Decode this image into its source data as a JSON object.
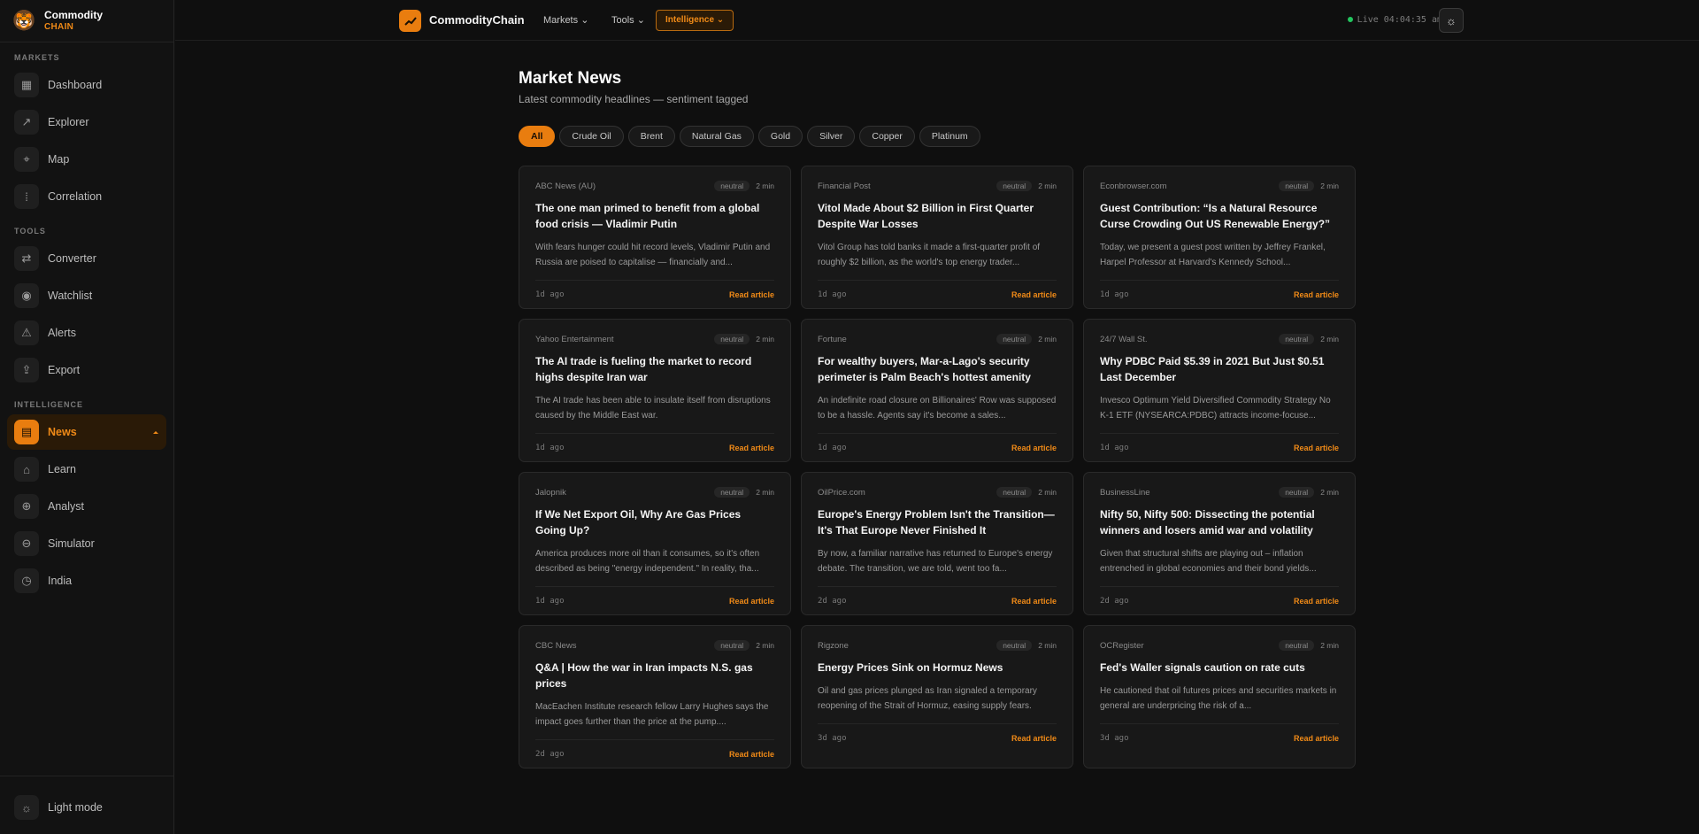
{
  "brand": {
    "name": "Commodity",
    "sub": "CHAIN"
  },
  "sidebar": {
    "sections": [
      {
        "heading": "MARKETS",
        "items": [
          {
            "label": "Dashboard",
            "icon": "grid-icon",
            "glyph": "▦"
          },
          {
            "label": "Explorer",
            "icon": "trend-line-icon",
            "glyph": "↗"
          },
          {
            "label": "Map",
            "icon": "map-pin-icon",
            "glyph": "⌖"
          },
          {
            "label": "Correlation",
            "icon": "dots-grid-icon",
            "glyph": "⁞"
          }
        ]
      },
      {
        "heading": "TOOLS",
        "items": [
          {
            "label": "Converter",
            "icon": "swap-icon",
            "glyph": "⇄"
          },
          {
            "label": "Watchlist",
            "icon": "eye-icon",
            "glyph": "◉"
          },
          {
            "label": "Alerts",
            "icon": "warning-icon",
            "glyph": "⚠"
          },
          {
            "label": "Export",
            "icon": "upload-icon",
            "glyph": "⇪"
          }
        ]
      },
      {
        "heading": "INTELLIGENCE",
        "items": [
          {
            "label": "News",
            "icon": "news-icon",
            "glyph": "▤",
            "active": true
          },
          {
            "label": "Learn",
            "icon": "graduation-cap-icon",
            "glyph": "⌂"
          },
          {
            "label": "Analyst",
            "icon": "plus-circle-icon",
            "glyph": "⊕"
          },
          {
            "label": "Simulator",
            "icon": "toggle-icon",
            "glyph": "⊖"
          },
          {
            "label": "India",
            "icon": "clock-icon",
            "glyph": "◷"
          }
        ]
      }
    ],
    "footer": {
      "label": "Light mode",
      "icon": "sun-icon",
      "glyph": "☼"
    }
  },
  "topbar": {
    "brand": "CommodityChain",
    "menus": {
      "markets": "Markets",
      "tools": "Tools",
      "intelligence": "Intelligence"
    },
    "live": "Live 04:04:35 am"
  },
  "main": {
    "title": "Market News",
    "subtitle": "Latest commodity headlines — sentiment tagged",
    "filters": [
      "All",
      "Crude Oil",
      "Brent",
      "Natural Gas",
      "Gold",
      "Silver",
      "Copper",
      "Platinum"
    ],
    "active_filter": "All",
    "read_label": "Read article",
    "articles": [
      {
        "source": "ABC News (AU)",
        "sentiment": "neutral",
        "read": "2 min",
        "title": "The one man primed to benefit from a global food crisis — Vladimir Putin",
        "desc": "With fears hunger could hit record levels, Vladimir Putin and Russia are poised to capitalise — financially and...",
        "ago": "1d ago"
      },
      {
        "source": "Financial Post",
        "sentiment": "neutral",
        "read": "2 min",
        "title": "Vitol Made About $2 Billion in First Quarter Despite War Losses",
        "desc": "Vitol Group has told banks it made a first-quarter profit of roughly $2 billion, as the world's top energy trader...",
        "ago": "1d ago"
      },
      {
        "source": "Econbrowser.com",
        "sentiment": "neutral",
        "read": "2 min",
        "title": "Guest Contribution: “Is a Natural Resource Curse Crowding Out US Renewable Energy?”",
        "desc": "Today, we present a guest post written by Jeffrey Frankel, Harpel Professor at Harvard's Kennedy School...",
        "ago": "1d ago"
      },
      {
        "source": "Yahoo Entertainment",
        "sentiment": "neutral",
        "read": "2 min",
        "title": "The AI trade is fueling the market to record highs despite Iran war",
        "desc": "The AI trade has been able to insulate itself from disruptions caused by the Middle East war.",
        "ago": "1d ago"
      },
      {
        "source": "Fortune",
        "sentiment": "neutral",
        "read": "2 min",
        "title": "For wealthy buyers, Mar-a-Lago's security perimeter is Palm Beach's hottest amenity",
        "desc": "An indefinite road closure on Billionaires' Row was supposed to be a hassle. Agents say it's become a sales...",
        "ago": "1d ago"
      },
      {
        "source": "24/7 Wall St.",
        "sentiment": "neutral",
        "read": "2 min",
        "title": "Why PDBC Paid $5.39 in 2021 But Just $0.51 Last December",
        "desc": "Invesco Optimum Yield Diversified Commodity Strategy No K-1 ETF (NYSEARCA:PDBC) attracts income-focuse...",
        "ago": "1d ago"
      },
      {
        "source": "Jalopnik",
        "sentiment": "neutral",
        "read": "2 min",
        "title": "If We Net Export Oil, Why Are Gas Prices Going Up?",
        "desc": "America produces more oil than it consumes, so it's often described as being \"energy independent.\" In reality, tha...",
        "ago": "1d ago"
      },
      {
        "source": "OilPrice.com",
        "sentiment": "neutral",
        "read": "2 min",
        "title": "Europe's Energy Problem Isn't the Transition—It's That Europe Never Finished It",
        "desc": "By now, a familiar narrative has returned to Europe's energy debate. The transition, we are told, went too fa...",
        "ago": "2d ago"
      },
      {
        "source": "BusinessLine",
        "sentiment": "neutral",
        "read": "2 min",
        "title": "Nifty 50, Nifty 500: Dissecting the potential winners and losers amid war and volatility",
        "desc": "Given that structural shifts are playing out – inflation entrenched in global economies and their bond yields...",
        "ago": "2d ago"
      },
      {
        "source": "CBC News",
        "sentiment": "neutral",
        "read": "2 min",
        "title": "Q&A | How the war in Iran impacts N.S. gas prices",
        "desc": "MacEachen Institute research fellow Larry Hughes says the impact goes further than the price at the pump....",
        "ago": "2d ago"
      },
      {
        "source": "Rigzone",
        "sentiment": "neutral",
        "read": "2 min",
        "title": "Energy Prices Sink on Hormuz News",
        "desc": "Oil and gas prices plunged as Iran signaled a temporary reopening of the Strait of Hormuz, easing supply fears.",
        "ago": "3d ago"
      },
      {
        "source": "OCRegister",
        "sentiment": "neutral",
        "read": "2 min",
        "title": "Fed's Waller signals caution on rate cuts",
        "desc": "He cautioned that oil futures prices and securities markets in general are underpricing the risk of a...",
        "ago": "3d ago"
      }
    ]
  },
  "colors": {
    "accent": "#e97d0f",
    "background": "#0f0f0f",
    "card": "#181818",
    "live": "#22c55e"
  }
}
